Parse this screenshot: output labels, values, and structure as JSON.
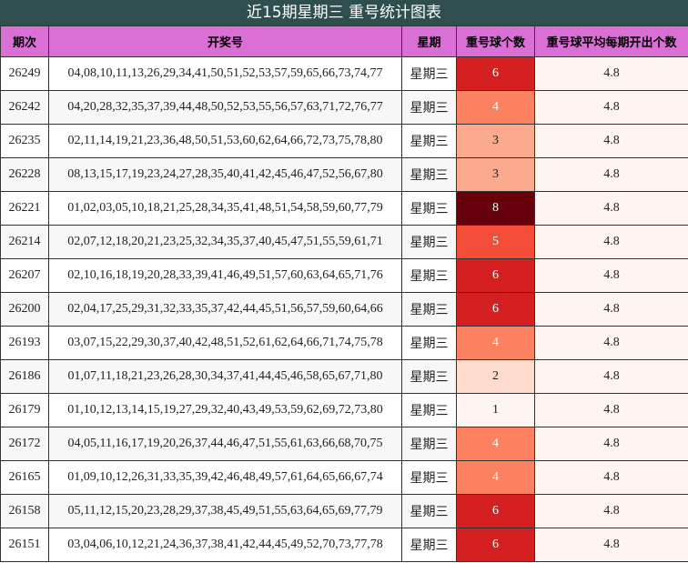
{
  "title": "近15期星期三 重号统计图表",
  "headers": {
    "period": "期次",
    "numbers": "开奖号",
    "weekday": "星期",
    "repeat": "重号球个数",
    "avg": "重号球平均每期开出个数"
  },
  "colors": {
    "header_bg": "#da70d6",
    "title_bg": "#2f4f4f",
    "avg_bg": "#fff5f0"
  },
  "rows": [
    {
      "period": "26249",
      "numbers": "04,08,10,11,13,26,29,34,41,50,51,52,53,57,59,65,66,73,74,77",
      "weekday": "星期三",
      "repeat": "6",
      "avg": "4.8",
      "color": "#d42020"
    },
    {
      "period": "26242",
      "numbers": "04,20,28,32,35,37,39,44,48,50,52,53,55,56,57,63,71,72,76,77",
      "weekday": "星期三",
      "repeat": "4",
      "avg": "4.8",
      "color": "#fc8161"
    },
    {
      "period": "26235",
      "numbers": "02,11,14,19,21,23,36,48,50,51,53,60,62,64,66,72,73,75,78,80",
      "weekday": "星期三",
      "repeat": "3",
      "avg": "4.8",
      "color": "#fcaa8e"
    },
    {
      "period": "26228",
      "numbers": "08,13,15,17,19,23,24,27,28,35,40,41,42,45,46,47,52,56,67,80",
      "weekday": "星期三",
      "repeat": "3",
      "avg": "4.8",
      "color": "#fcaa8e"
    },
    {
      "period": "26221",
      "numbers": "01,02,03,05,10,18,21,25,28,34,35,41,48,51,54,58,59,60,77,79",
      "weekday": "星期三",
      "repeat": "8",
      "avg": "4.8",
      "color": "#67000d"
    },
    {
      "period": "26214",
      "numbers": "02,07,12,18,20,21,23,25,32,34,35,37,40,45,47,51,55,59,61,71",
      "weekday": "星期三",
      "repeat": "5",
      "avg": "4.8",
      "color": "#f34c37"
    },
    {
      "period": "26207",
      "numbers": "02,10,16,18,19,20,28,33,39,41,46,49,51,57,60,63,64,65,71,76",
      "weekday": "星期三",
      "repeat": "6",
      "avg": "4.8",
      "color": "#d42020"
    },
    {
      "period": "26200",
      "numbers": "02,04,17,25,29,31,32,33,35,37,42,44,45,51,56,57,59,60,64,66",
      "weekday": "星期三",
      "repeat": "6",
      "avg": "4.8",
      "color": "#d42020"
    },
    {
      "period": "26193",
      "numbers": "03,07,15,22,29,30,37,40,42,48,51,52,61,62,64,66,71,74,75,78",
      "weekday": "星期三",
      "repeat": "4",
      "avg": "4.8",
      "color": "#fc8161"
    },
    {
      "period": "26186",
      "numbers": "01,07,11,18,21,23,26,28,30,34,37,41,44,45,46,58,65,67,71,80",
      "weekday": "星期三",
      "repeat": "2",
      "avg": "4.8",
      "color": "#fedbcc"
    },
    {
      "period": "26179",
      "numbers": "01,10,12,13,14,15,19,27,29,32,40,43,49,53,59,62,69,72,73,80",
      "weekday": "星期三",
      "repeat": "1",
      "avg": "4.8",
      "color": "#fff5f0"
    },
    {
      "period": "26172",
      "numbers": "04,05,11,16,17,19,20,26,37,44,46,47,51,55,61,63,66,68,70,75",
      "weekday": "星期三",
      "repeat": "4",
      "avg": "4.8",
      "color": "#fc8161"
    },
    {
      "period": "26165",
      "numbers": "01,09,10,12,26,31,33,35,39,42,46,48,49,57,61,64,65,66,67,74",
      "weekday": "星期三",
      "repeat": "4",
      "avg": "4.8",
      "color": "#fc8161"
    },
    {
      "period": "26158",
      "numbers": "05,11,12,15,20,23,28,29,37,38,45,49,51,55,63,64,65,69,77,79",
      "weekday": "星期三",
      "repeat": "6",
      "avg": "4.8",
      "color": "#d42020"
    },
    {
      "period": "26151",
      "numbers": "03,04,06,10,12,21,24,36,37,38,41,42,44,45,49,52,70,73,77,78",
      "weekday": "星期三",
      "repeat": "6",
      "avg": "4.8",
      "color": "#d42020"
    }
  ]
}
